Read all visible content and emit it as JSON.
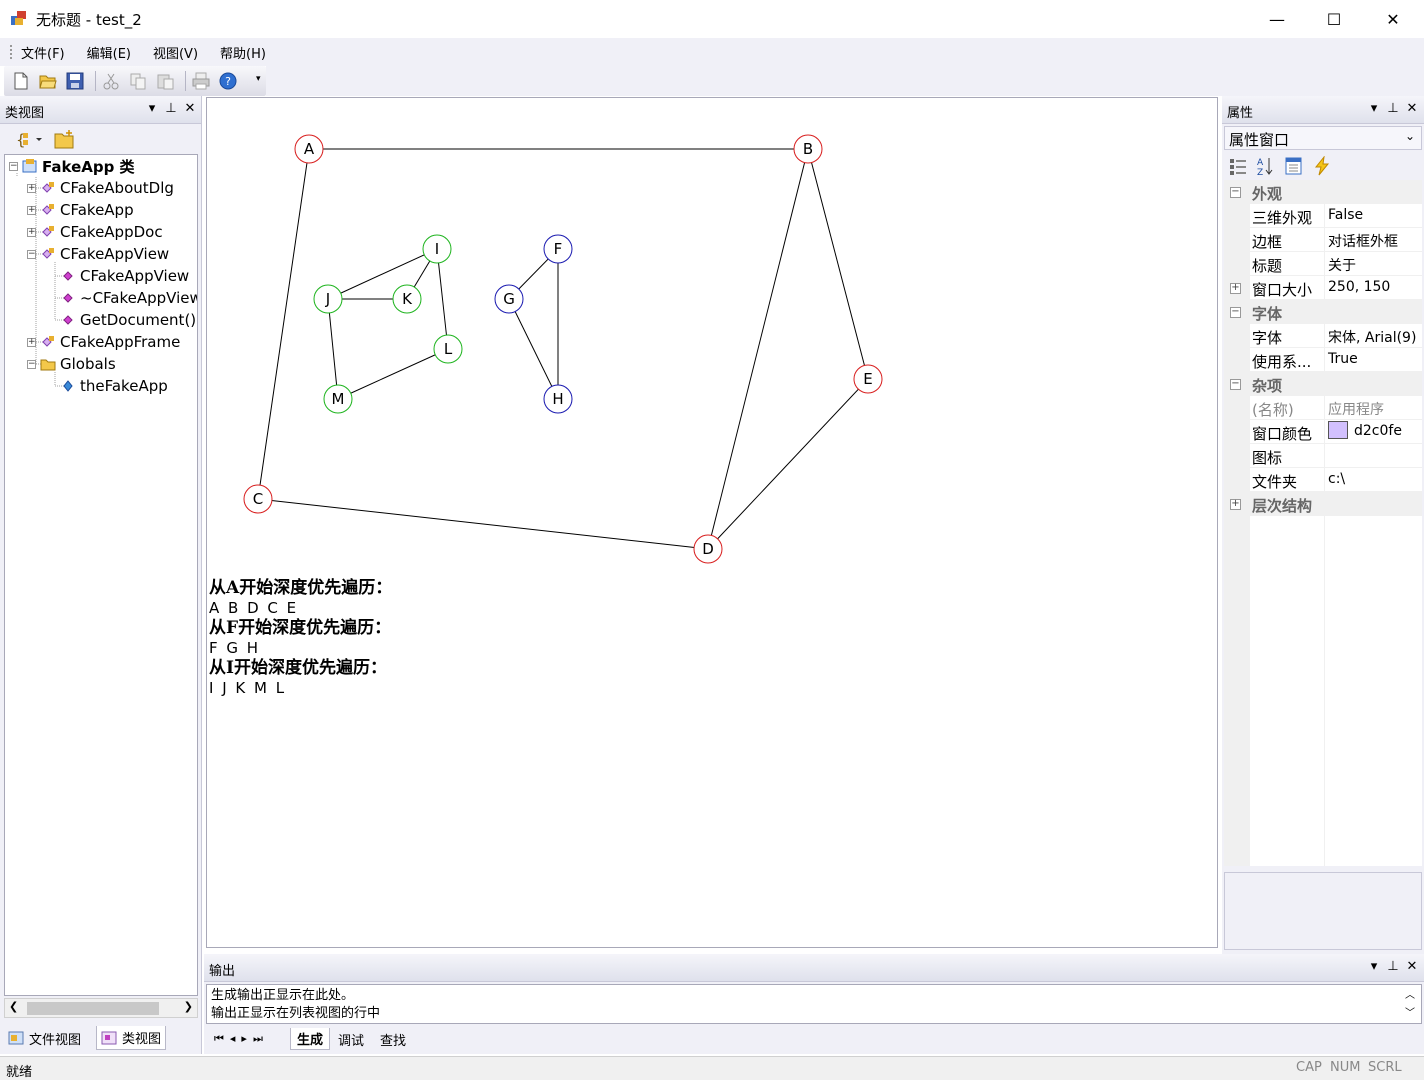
{
  "window": {
    "title": "无标题 - test_2",
    "minimize_label": "—",
    "maximize_label": "☐",
    "close_label": "✕"
  },
  "menu": [
    "文件(F)",
    "编辑(E)",
    "视图(V)",
    "帮助(H)"
  ],
  "toolbar": {
    "icons": [
      "new-file-icon",
      "open-folder-icon",
      "save-icon",
      "cut-icon",
      "copy-icon",
      "paste-icon",
      "print-icon",
      "help-icon"
    ]
  },
  "class_view": {
    "title": "类视图",
    "tree": [
      {
        "label": "FakeApp 类",
        "depth": 0,
        "expander": "−",
        "bold": true
      },
      {
        "label": "CFakeAboutDlg",
        "depth": 1,
        "expander": "+"
      },
      {
        "label": "CFakeApp",
        "depth": 1,
        "expander": "+"
      },
      {
        "label": "CFakeAppDoc",
        "depth": 1,
        "expander": "+"
      },
      {
        "label": "CFakeAppView",
        "depth": 1,
        "expander": "−"
      },
      {
        "label": "CFakeAppView",
        "depth": 2,
        "expander": ""
      },
      {
        "label": "~CFakeAppView",
        "depth": 2,
        "expander": ""
      },
      {
        "label": "GetDocument()",
        "depth": 2,
        "expander": ""
      },
      {
        "label": "CFakeAppFrame",
        "depth": 1,
        "expander": "+"
      },
      {
        "label": "Globals",
        "depth": 1,
        "expander": "−"
      },
      {
        "label": "theFakeApp",
        "depth": 2,
        "expander": ""
      }
    ],
    "tabs": [
      "文件视图",
      "类视图"
    ]
  },
  "graph": {
    "nodes": [
      {
        "id": "A",
        "color": "#d81e1e"
      },
      {
        "id": "B",
        "color": "#d81e1e"
      },
      {
        "id": "C",
        "color": "#d81e1e"
      },
      {
        "id": "D",
        "color": "#d81e1e"
      },
      {
        "id": "E",
        "color": "#d81e1e"
      },
      {
        "id": "F",
        "color": "#1a1ab0"
      },
      {
        "id": "G",
        "color": "#1a1ab0"
      },
      {
        "id": "H",
        "color": "#1a1ab0"
      },
      {
        "id": "I",
        "color": "#1eb41e"
      },
      {
        "id": "J",
        "color": "#1eb41e"
      },
      {
        "id": "K",
        "color": "#1eb41e"
      },
      {
        "id": "L",
        "color": "#1eb41e"
      },
      {
        "id": "M",
        "color": "#1eb41e"
      }
    ],
    "edges": [
      [
        "A",
        "B"
      ],
      [
        "A",
        "C"
      ],
      [
        "B",
        "D"
      ],
      [
        "B",
        "E"
      ],
      [
        "C",
        "D"
      ],
      [
        "D",
        "E"
      ],
      [
        "F",
        "G"
      ],
      [
        "F",
        "H"
      ],
      [
        "G",
        "H"
      ],
      [
        "I",
        "J"
      ],
      [
        "I",
        "K"
      ],
      [
        "I",
        "L"
      ],
      [
        "J",
        "K"
      ],
      [
        "J",
        "M"
      ],
      [
        "L",
        "M"
      ]
    ]
  },
  "traversal": {
    "lines": [
      {
        "head": "从A开始深度优先遍历：",
        "seq": "A B D C E"
      },
      {
        "head": "从F开始深度优先遍历：",
        "seq": "F G H"
      },
      {
        "head": "从I开始深度优先遍历：",
        "seq": "I J K M L"
      }
    ]
  },
  "properties": {
    "title": "属性",
    "selector": "属性窗口",
    "rows": [
      {
        "type": "cat",
        "name": "外观",
        "exp": "−"
      },
      {
        "type": "item",
        "name": "三维外观",
        "value": "False"
      },
      {
        "type": "item",
        "name": "边框",
        "value": "对话框外框"
      },
      {
        "type": "item",
        "name": "标题",
        "value": "关于"
      },
      {
        "type": "item",
        "name": "窗口大小",
        "value": "250, 150",
        "exp": "+"
      },
      {
        "type": "cat",
        "name": "字体",
        "exp": "−"
      },
      {
        "type": "item",
        "name": "字体",
        "value": "宋体, Arial(9)"
      },
      {
        "type": "item",
        "name": "使用系...",
        "value": "True"
      },
      {
        "type": "cat",
        "name": "杂项",
        "exp": "−"
      },
      {
        "type": "item",
        "name": "(名称)",
        "value": "应用程序",
        "gray": true
      },
      {
        "type": "item",
        "name": "窗口颜色",
        "value": "d2c0fe",
        "swatch": "#d2c0fe"
      },
      {
        "type": "item",
        "name": "图标",
        "value": ""
      },
      {
        "type": "item",
        "name": "文件夹",
        "value": "c:\\"
      },
      {
        "type": "cat",
        "name": "层次结构",
        "exp": "+"
      }
    ]
  },
  "output": {
    "title": "输出",
    "lines": [
      "生成输出正显示在此处。",
      "输出正显示在列表视图的行中"
    ],
    "tabs": [
      "生成",
      "调试",
      "查找"
    ]
  },
  "status": {
    "text": "就绪",
    "indicators": [
      "CAP",
      "NUM",
      "SCRL"
    ]
  }
}
